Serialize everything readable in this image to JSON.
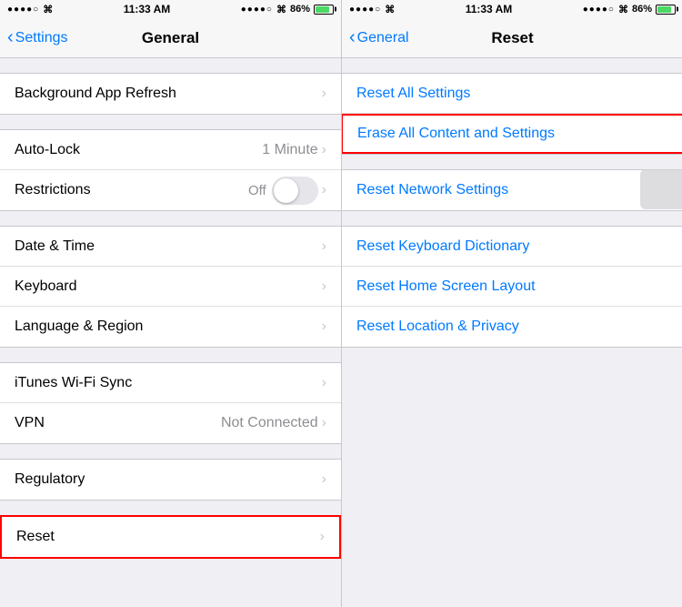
{
  "left_panel": {
    "status_bar": {
      "signal": "●●●●○",
      "time": "11:33 AM",
      "carrier": "●●●●○",
      "wifi": "WiFi",
      "battery_percent": "86%",
      "battery_fill": "86"
    },
    "nav": {
      "back_label": "Settings",
      "title": "General"
    },
    "sections": [
      {
        "rows": [
          {
            "label": "Background App Refresh",
            "value": "",
            "has_chevron": true
          }
        ]
      },
      {
        "rows": [
          {
            "label": "Auto-Lock",
            "value": "1 Minute",
            "has_chevron": true
          },
          {
            "label": "Restrictions",
            "value": "Off",
            "has_toggle": true
          }
        ]
      },
      {
        "rows": [
          {
            "label": "Date & Time",
            "value": "",
            "has_chevron": true
          },
          {
            "label": "Keyboard",
            "value": "",
            "has_chevron": true
          },
          {
            "label": "Language & Region",
            "value": "",
            "has_chevron": true
          }
        ]
      },
      {
        "rows": [
          {
            "label": "iTunes Wi-Fi Sync",
            "value": "",
            "has_chevron": true
          },
          {
            "label": "VPN",
            "value": "Not Connected",
            "has_chevron": true
          }
        ]
      },
      {
        "rows": [
          {
            "label": "Regulatory",
            "value": "",
            "has_chevron": true
          }
        ]
      },
      {
        "rows": [
          {
            "label": "Reset",
            "value": "",
            "has_chevron": true,
            "highlighted": true
          }
        ]
      }
    ]
  },
  "right_panel": {
    "status_bar": {
      "signal": "●●●●○",
      "time": "11:33 AM",
      "carrier": "●●●●○",
      "wifi": "WiFi",
      "battery_percent": "86%",
      "battery_fill": "86"
    },
    "nav": {
      "back_label": "General",
      "title": "Reset"
    },
    "sections": [
      {
        "rows": [
          {
            "label": "Reset All Settings",
            "highlighted": false
          },
          {
            "label": "Erase All Content and Settings",
            "highlighted": true
          }
        ]
      },
      {
        "rows": [
          {
            "label": "Reset Network Settings"
          }
        ]
      },
      {
        "rows": [
          {
            "label": "Reset Keyboard Dictionary"
          },
          {
            "label": "Reset Home Screen Layout"
          },
          {
            "label": "Reset Location & Privacy"
          }
        ]
      }
    ]
  }
}
